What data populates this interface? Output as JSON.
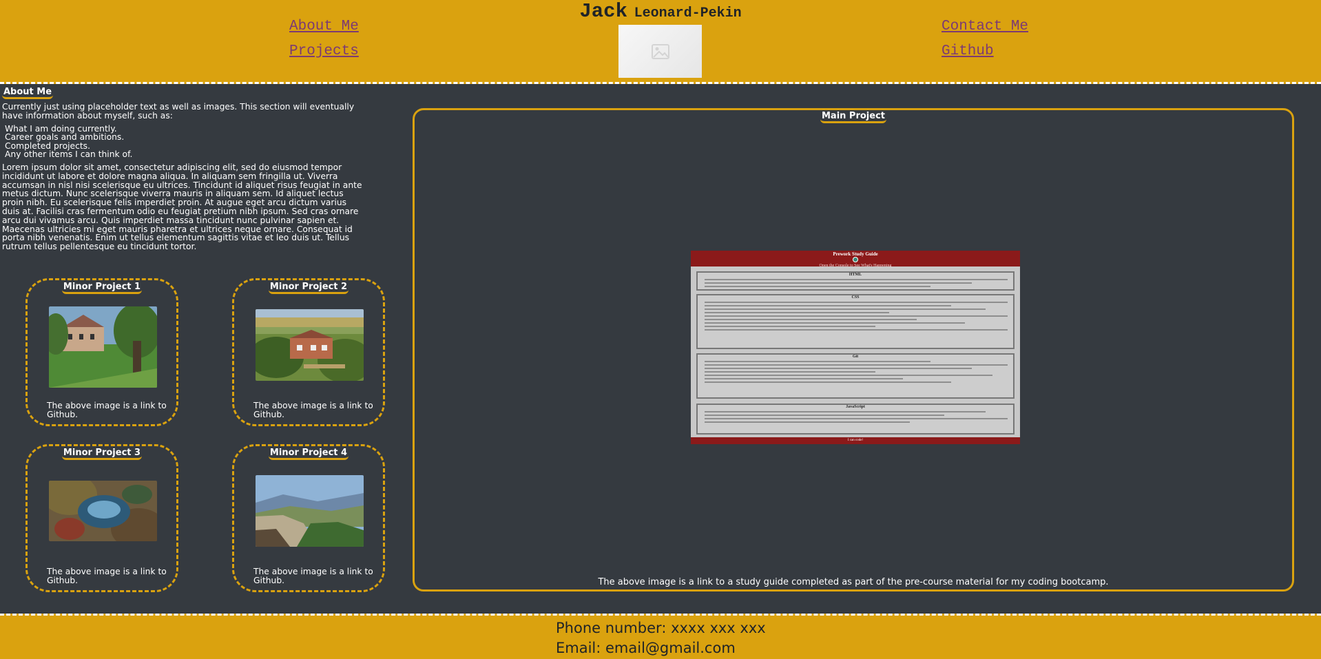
{
  "header": {
    "first_name": "Jack",
    "last_name": "Leonard-Pekin",
    "nav": {
      "about": "About Me",
      "projects": "Projects",
      "contact": "Contact Me",
      "github": "Github"
    }
  },
  "about": {
    "heading": "About Me",
    "intro": "Currently just using placeholder text as well as images. This section will eventually have information about myself, such as:",
    "items": [
      "What I am doing currently.",
      "Career goals and ambitions.",
      "Completed projects.",
      "Any other items I can think of."
    ],
    "lorem": "Lorem ipsum dolor sit amet, consectetur adipiscing elit, sed do eiusmod tempor incididunt ut labore et dolore magna aliqua. In aliquam sem fringilla ut. Viverra accumsan in nisl nisi scelerisque eu ultrices. Tincidunt id aliquet risus feugiat in ante metus dictum. Nunc scelerisque viverra mauris in aliquam sem. Id aliquet lectus proin nibh. Eu scelerisque felis imperdiet proin. At augue eget arcu dictum varius duis at. Facilisi cras fermentum odio eu feugiat pretium nibh ipsum. Sed cras ornare arcu dui vivamus arcu. Quis imperdiet massa tincidunt nunc pulvinar sapien et. Maecenas ultricies mi eget mauris pharetra et ultrices neque ornare. Consequat id porta nibh venenatis. Enim ut tellus elementum sagittis vitae et leo duis ut. Tellus rutrum tellus pellentesque eu tincidunt tortor."
  },
  "minor_projects": [
    {
      "title": "Minor Project 1",
      "caption": "The above image is a link to Github."
    },
    {
      "title": "Minor Project 2",
      "caption": "The above image is a link to Github."
    },
    {
      "title": "Minor Project 3",
      "caption": "The above image is a link to Github."
    },
    {
      "title": "Minor Project 4",
      "caption": "The above image is a link to Github."
    }
  ],
  "main_project": {
    "heading": "Main Project",
    "caption": "The above image is a link to a study guide completed as part of the pre-course material for my coding bootcamp.",
    "preview": {
      "title": "Prework Study Guide",
      "subtitle": "Open the Console to See What's Happening",
      "sections": [
        "HTML",
        "CSS",
        "Git",
        "JavaScript"
      ],
      "footer": "I can code!"
    }
  },
  "footer": {
    "phone": "Phone number: xxxx xxx xxx",
    "email": "Email: email@gmail.com"
  },
  "colors": {
    "accent": "#daa20f",
    "background": "#353a40",
    "link": "#7c3a73",
    "study_guide_red": "#8b1a1a"
  }
}
